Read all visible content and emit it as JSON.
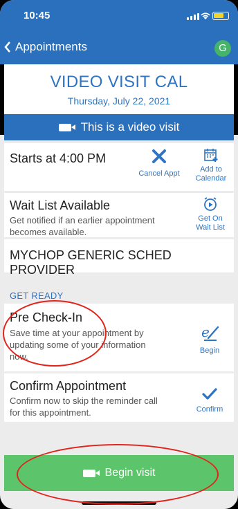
{
  "status": {
    "time": "10:45"
  },
  "nav": {
    "back_label": "Appointments",
    "avatar_initial": "G"
  },
  "header": {
    "title": "VIDEO VISIT CAL",
    "date": "Thursday, July 22, 2021",
    "video_banner": "This is a video visit"
  },
  "appointment": {
    "start_text": "Starts at 4:00 PM",
    "cancel_label": "Cancel Appt",
    "calendar_label_1": "Add to",
    "calendar_label_2": "Calendar"
  },
  "waitlist": {
    "title": "Wait List Available",
    "desc_line1": "Get notified if an earlier appointment",
    "desc_line2": "becomes available.",
    "action_label_1": "Get On",
    "action_label_2": "Wait List"
  },
  "provider": {
    "name": "MYCHOP GENERIC SCHED PROVIDER"
  },
  "get_ready": {
    "section_label": "GET READY",
    "precheckin": {
      "title": "Pre Check-In",
      "desc_line1": "Save time at your appointment by",
      "desc_line2": "updating some of your information",
      "desc_line3": "now.",
      "action_label": "Begin"
    },
    "confirm": {
      "title": "Confirm Appointment",
      "desc_line1": "Confirm now to skip the reminder call",
      "desc_line2": "for this appointment.",
      "action_label": "Confirm"
    }
  },
  "begin_visit": {
    "label": "Begin visit"
  },
  "colors": {
    "brand_blue": "#2b70bd",
    "action_blue": "#2e74c3",
    "begin_green": "#5cc46a",
    "annotation_red": "#e2231a"
  },
  "icons": [
    "chevron-left-icon",
    "calendar-add-icon",
    "close-icon",
    "waitlist-icon",
    "checkin-pen-icon",
    "checkmark-icon",
    "video-camera-icon"
  ]
}
